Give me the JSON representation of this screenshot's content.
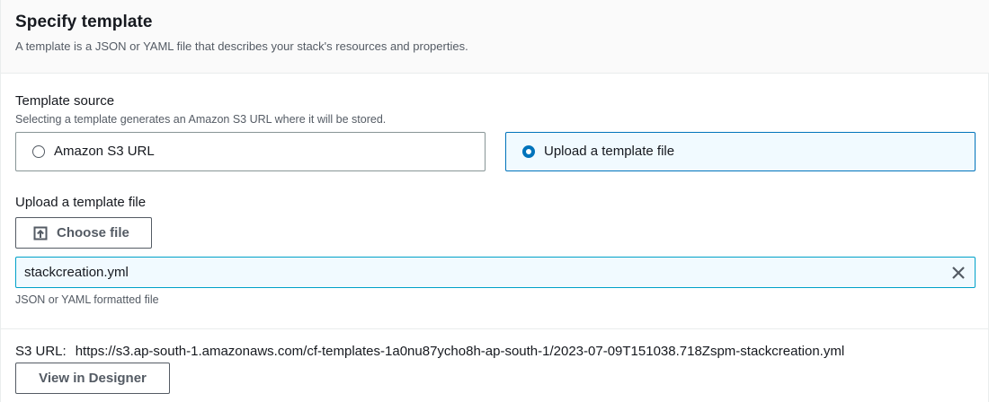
{
  "header": {
    "title": "Specify template",
    "description": "A template is a JSON or YAML file that describes your stack's resources and properties."
  },
  "template_source": {
    "label": "Template source",
    "hint": "Selecting a template generates an Amazon S3 URL where it will be stored.",
    "options": [
      {
        "label": "Amazon S3 URL",
        "selected": false
      },
      {
        "label": "Upload a template file",
        "selected": true
      }
    ]
  },
  "upload": {
    "label": "Upload a template file",
    "choose_button": "Choose file",
    "file_name": "stackcreation.yml",
    "hint": "JSON or YAML formatted file"
  },
  "s3": {
    "label": "S3 URL:",
    "url": "https://s3.ap-south-1.amazonaws.com/cf-templates-1a0nu87ycho8h-ap-south-1/2023-07-09T151038.718Zspm-stackcreation.yml"
  },
  "designer_button": "View in Designer",
  "colors": {
    "accent": "#0073bb",
    "selected_bg": "#f1faff",
    "focus_border": "#00a1c9",
    "text_secondary": "#545b64"
  },
  "icons": {
    "upload": "upload-icon",
    "clear": "close-icon"
  }
}
